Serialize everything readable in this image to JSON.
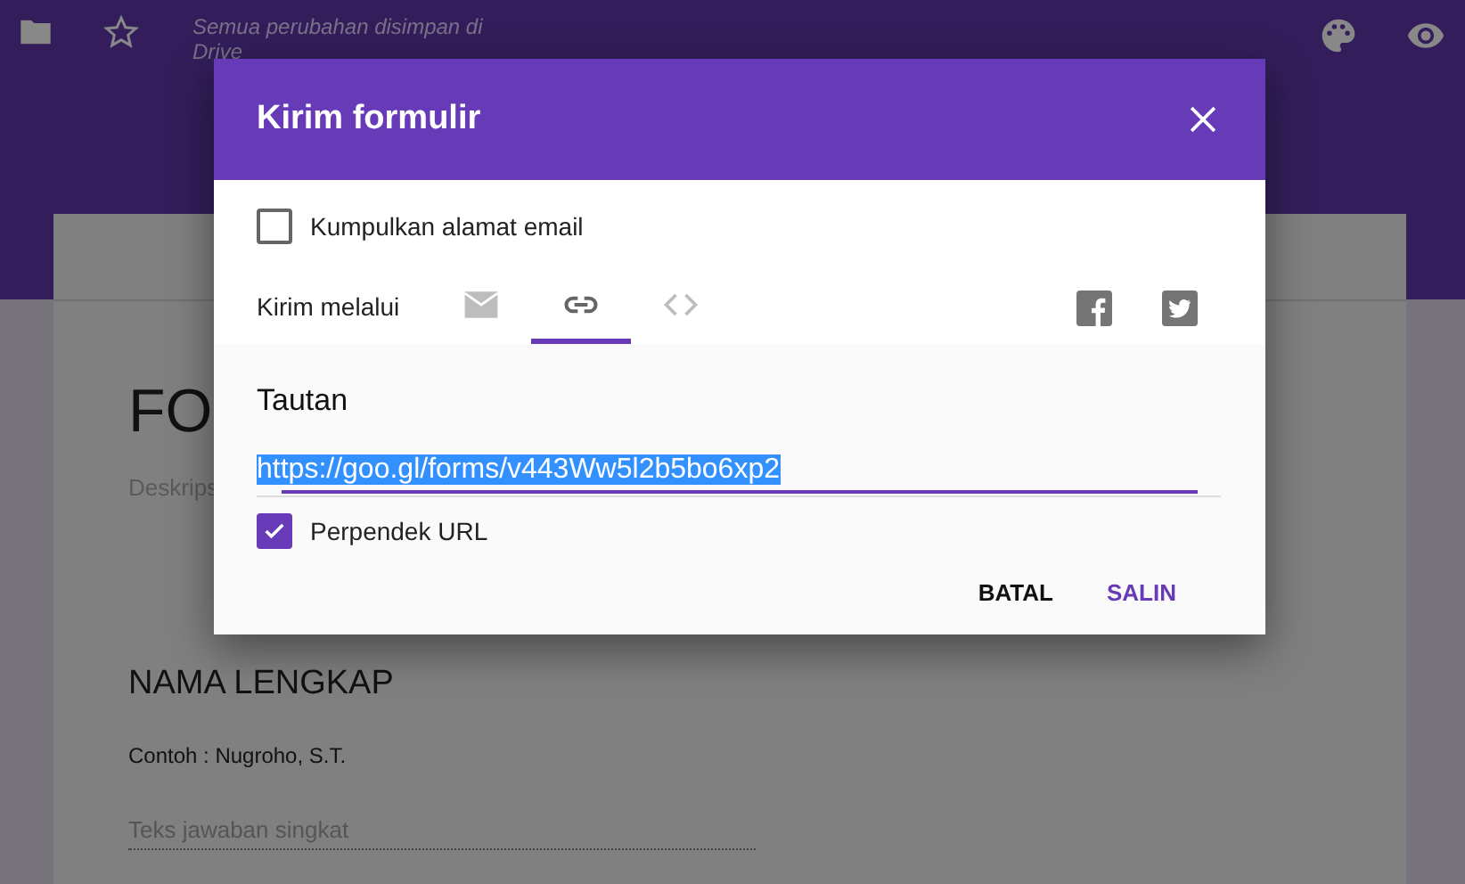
{
  "toolbar": {
    "save_status": "Semua perubahan disimpan di Drive"
  },
  "form": {
    "title": "FO",
    "description": "Deskrips",
    "questions": [
      {
        "title": "NAMA LENGKAP",
        "help": "Contoh : Nugroho, S.T.",
        "placeholder": "Teks jawaban singkat"
      }
    ]
  },
  "dialog": {
    "title": "Kirim formulir",
    "collect_email": {
      "label": "Kumpulkan alamat email",
      "checked": false
    },
    "send_via": {
      "label": "Kirim melalui",
      "tabs": [
        {
          "kind": "email",
          "selected": false
        },
        {
          "kind": "link",
          "selected": true
        },
        {
          "kind": "embed",
          "selected": false
        }
      ],
      "social": [
        {
          "kind": "facebook"
        },
        {
          "kind": "twitter"
        }
      ]
    },
    "link": {
      "heading": "Tautan",
      "value": "https://goo.gl/forms/v443Ww5l2b5bo6xp2",
      "shorten": {
        "label": "Perpendek URL",
        "checked": true
      }
    },
    "buttons": [
      {
        "label": "BATAL",
        "kind": "cancel"
      },
      {
        "label": "SALIN",
        "kind": "primary"
      }
    ]
  }
}
